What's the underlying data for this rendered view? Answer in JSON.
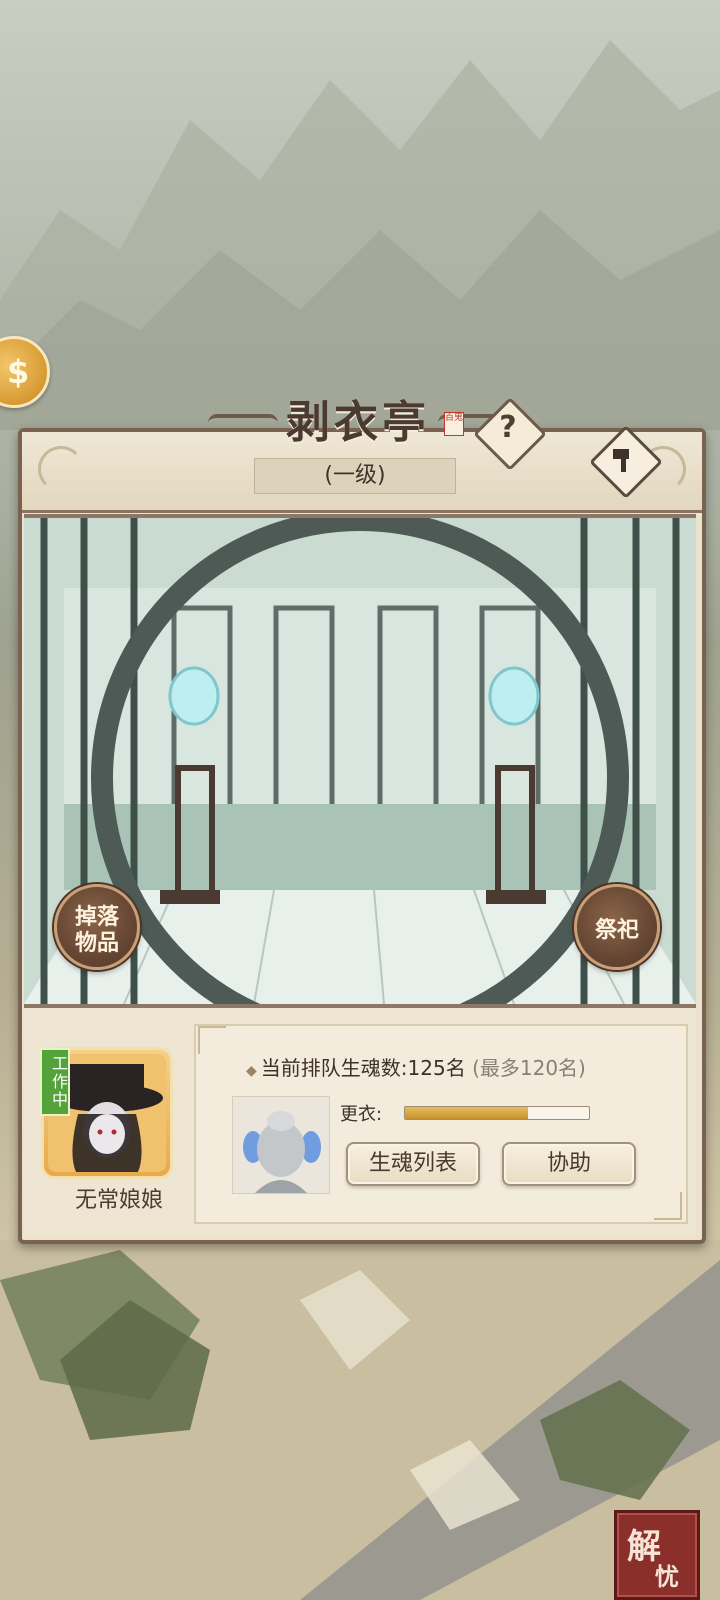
{
  "header": {
    "title": "剥衣亭",
    "seal": "百鬼",
    "level": "(一级)",
    "help_icon": "question-icon",
    "build_icon": "hammer-icon"
  },
  "scene": {
    "left_button_line1": "掉落",
    "left_button_line2": "物品",
    "right_button": "祭祀"
  },
  "npc": {
    "status": "工作中",
    "name": "无常娘娘"
  },
  "queue": {
    "label": "当前排队生魂数:",
    "value": "125名",
    "max": "(最多120名)"
  },
  "task": {
    "label": "更衣:",
    "progress": 0.67
  },
  "buttons": {
    "soul_list": "生魂列表",
    "assist": "协助"
  },
  "corner_seal": {
    "text1": "解",
    "text2": "忧"
  },
  "colors": {
    "panel": "#ece3cf",
    "frame": "#7a6250",
    "progress": "#d9a645",
    "status_green": "#54a33a"
  }
}
